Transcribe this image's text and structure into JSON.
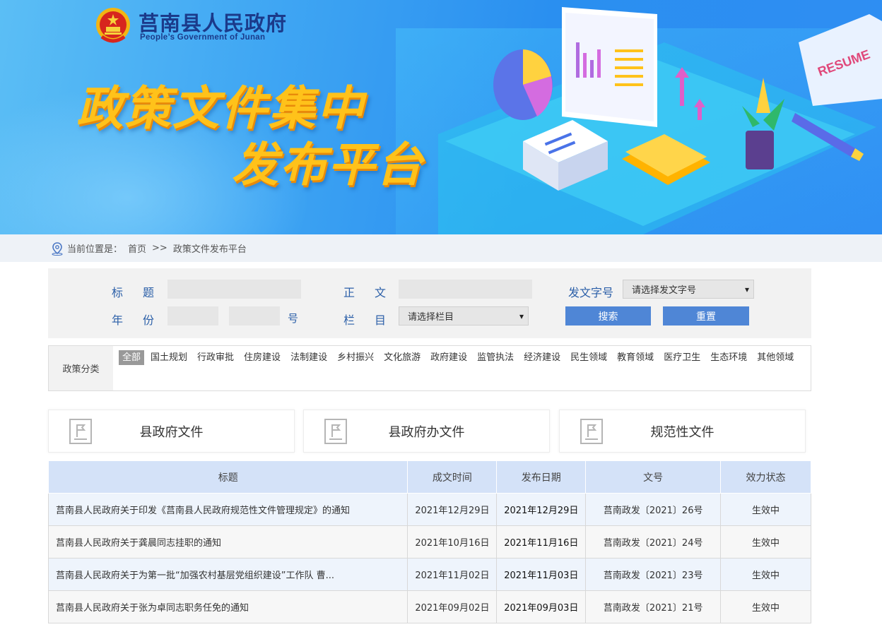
{
  "header": {
    "site_title": "莒南县人民政府",
    "site_subtitle": "People’s Government of Junan",
    "slogan_line1": "政策文件集中",
    "slogan_line2": "发布平台",
    "illustration_text": "RESUME"
  },
  "breadcrumb": {
    "prefix": "当前位置是：",
    "home": "首页",
    "separator": ">>",
    "current": "政策文件发布平台"
  },
  "search": {
    "title_label": "标题",
    "body_label": "正文",
    "doc_number_label": "发文字号",
    "doc_number_select": "请选择发文字号",
    "year_label": "年份",
    "year_value": "",
    "number_value": "",
    "number_suffix": "号",
    "column_label": "栏目",
    "column_select": "请选择栏目",
    "search_button": "搜索",
    "reset_button": "重置"
  },
  "categories": {
    "heading": "政策分类",
    "items": [
      "全部",
      "国土规划",
      "行政审批",
      "住房建设",
      "法制建设",
      "乡村振兴",
      "文化旅游",
      "政府建设",
      "监管执法",
      "经济建设",
      "民生领域",
      "教育领域",
      "医疗卫生",
      "生态环境",
      "其他领域"
    ],
    "active": "全部"
  },
  "doc_types": [
    "县政府文件",
    "县政府办文件",
    "规范性文件"
  ],
  "table": {
    "headers": [
      "标题",
      "成文时间",
      "发布日期",
      "文号",
      "效力状态"
    ],
    "rows": [
      {
        "title": "莒南县人民政府关于印发《莒南县人民政府规范性文件管理规定》的通知",
        "written": "2021年12月29日",
        "published": "2021年12月29日",
        "number": "莒南政发〔2021〕26号",
        "status": "生效中"
      },
      {
        "title": "莒南县人民政府关于龚晨同志挂职的通知",
        "written": "2021年10月16日",
        "published": "2021年11月16日",
        "number": "莒南政发〔2021〕24号",
        "status": "生效中"
      },
      {
        "title": "莒南县人民政府关于为第一批“加强农村基层党组织建设”工作队 曹...",
        "written": "2021年11月02日",
        "published": "2021年11月03日",
        "number": "莒南政发〔2021〕23号",
        "status": "生效中"
      },
      {
        "title": "莒南县人民政府关于张为卓同志职务任免的通知",
        "written": "2021年09月02日",
        "published": "2021年09月03日",
        "number": "莒南政发〔2021〕21号",
        "status": "生效中"
      }
    ]
  },
  "icons": {
    "emblem": "national-emblem-icon",
    "location": "location-pin-icon",
    "doc": "document-flag-icon"
  },
  "colors": {
    "banner_blue": "#2a8ff0",
    "slogan_yellow": "#ffc21a",
    "label_blue": "#2b5fa8",
    "button_blue": "#4f86d6",
    "table_header": "#d4e2f8"
  }
}
